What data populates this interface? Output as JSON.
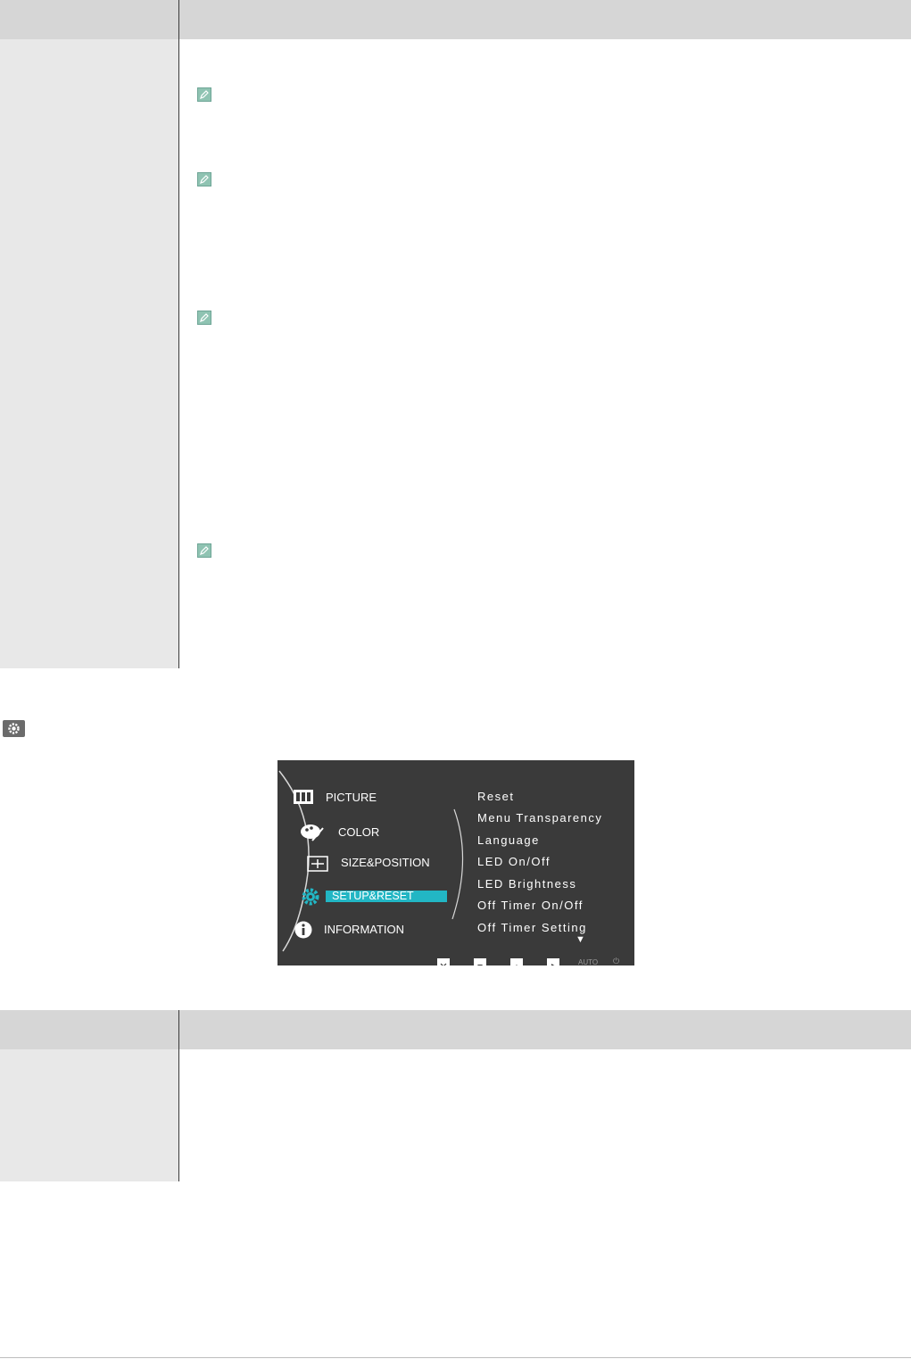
{
  "top_table": {
    "header": [
      "",
      ""
    ],
    "rows": [
      {
        "label": "",
        "desc": "",
        "note": ""
      },
      {
        "label": "",
        "desc": "",
        "note": ""
      },
      {
        "label": "",
        "desc": "",
        "note": "",
        "note2": ""
      },
      {
        "label": "",
        "desc": ""
      },
      {
        "label": "",
        "desc": ""
      }
    ]
  },
  "osd": {
    "main_menu": [
      "PICTURE",
      "COLOR",
      "SIZE&POSITION",
      "SETUP&RESET",
      "INFORMATION"
    ],
    "selected": "SETUP&RESET",
    "sub_menu": [
      "Reset",
      "Menu Transparency",
      "Language",
      "LED On/Off",
      "LED Brightness",
      "Off Timer On/Off",
      "Off Timer Setting"
    ],
    "more_indicator": "▼",
    "button_labels": {
      "auto": "AUTO",
      "power": "⏻"
    },
    "colors": {
      "background": "#3a3a3a",
      "highlight": "#22b6c4"
    }
  },
  "bottom_table": {
    "header": [
      "",
      ""
    ],
    "rows": [
      {
        "label": "",
        "desc": ""
      },
      {
        "label": "",
        "desc": ""
      }
    ]
  }
}
